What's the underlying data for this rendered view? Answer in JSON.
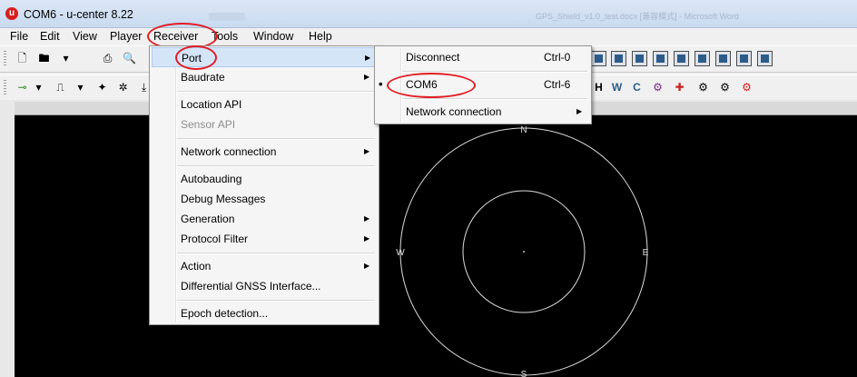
{
  "window": {
    "app_icon_letter": "u",
    "title": "COM6 - u-center 8.22",
    "background_title": "GPS_Shield_v1.0_test.docx [兼容模式] - Microsoft Word"
  },
  "menubar": {
    "items": [
      "File",
      "Edit",
      "View",
      "Player",
      "Receiver",
      "Tools",
      "Window",
      "Help"
    ]
  },
  "toolbar1": {
    "icons": [
      "new-file-icon",
      "open-folder-icon",
      "print-icon",
      "print-preview-icon"
    ]
  },
  "toolbar2": {
    "icons": [
      "connect-icon",
      "signal-icon",
      "magic-wand-icon",
      "bug-icon",
      "download-icon"
    ],
    "right_labels": [
      "H",
      "W",
      "C"
    ]
  },
  "receiver_menu": {
    "items": [
      {
        "label": "Port",
        "submenu": true
      },
      {
        "label": "Baudrate",
        "submenu": true
      },
      {
        "label": "Location API",
        "submenu": false
      },
      {
        "label": "Sensor API",
        "submenu": false,
        "disabled": true
      },
      {
        "label": "Network connection",
        "submenu": true
      },
      {
        "label": "Autobauding",
        "submenu": false
      },
      {
        "label": "Debug Messages",
        "submenu": false
      },
      {
        "label": "Generation",
        "submenu": true
      },
      {
        "label": "Protocol Filter",
        "submenu": true
      },
      {
        "label": "Action",
        "submenu": true
      },
      {
        "label": "Differential GNSS Interface...",
        "submenu": false
      },
      {
        "label": "Epoch detection...",
        "submenu": false
      }
    ]
  },
  "port_menu": {
    "items": [
      {
        "label": "Disconnect",
        "shortcut": "Ctrl-0"
      },
      {
        "label": "COM6",
        "shortcut": "Ctrl-6",
        "bullet": "•"
      },
      {
        "label": "Network connection",
        "submenu": true
      }
    ]
  },
  "sky_view": {
    "north": "N",
    "south": "S",
    "east": "E",
    "west": "W"
  },
  "colors": {
    "highlight_circle": "#e11d24",
    "menu_highlight": "#d5e5f8"
  }
}
